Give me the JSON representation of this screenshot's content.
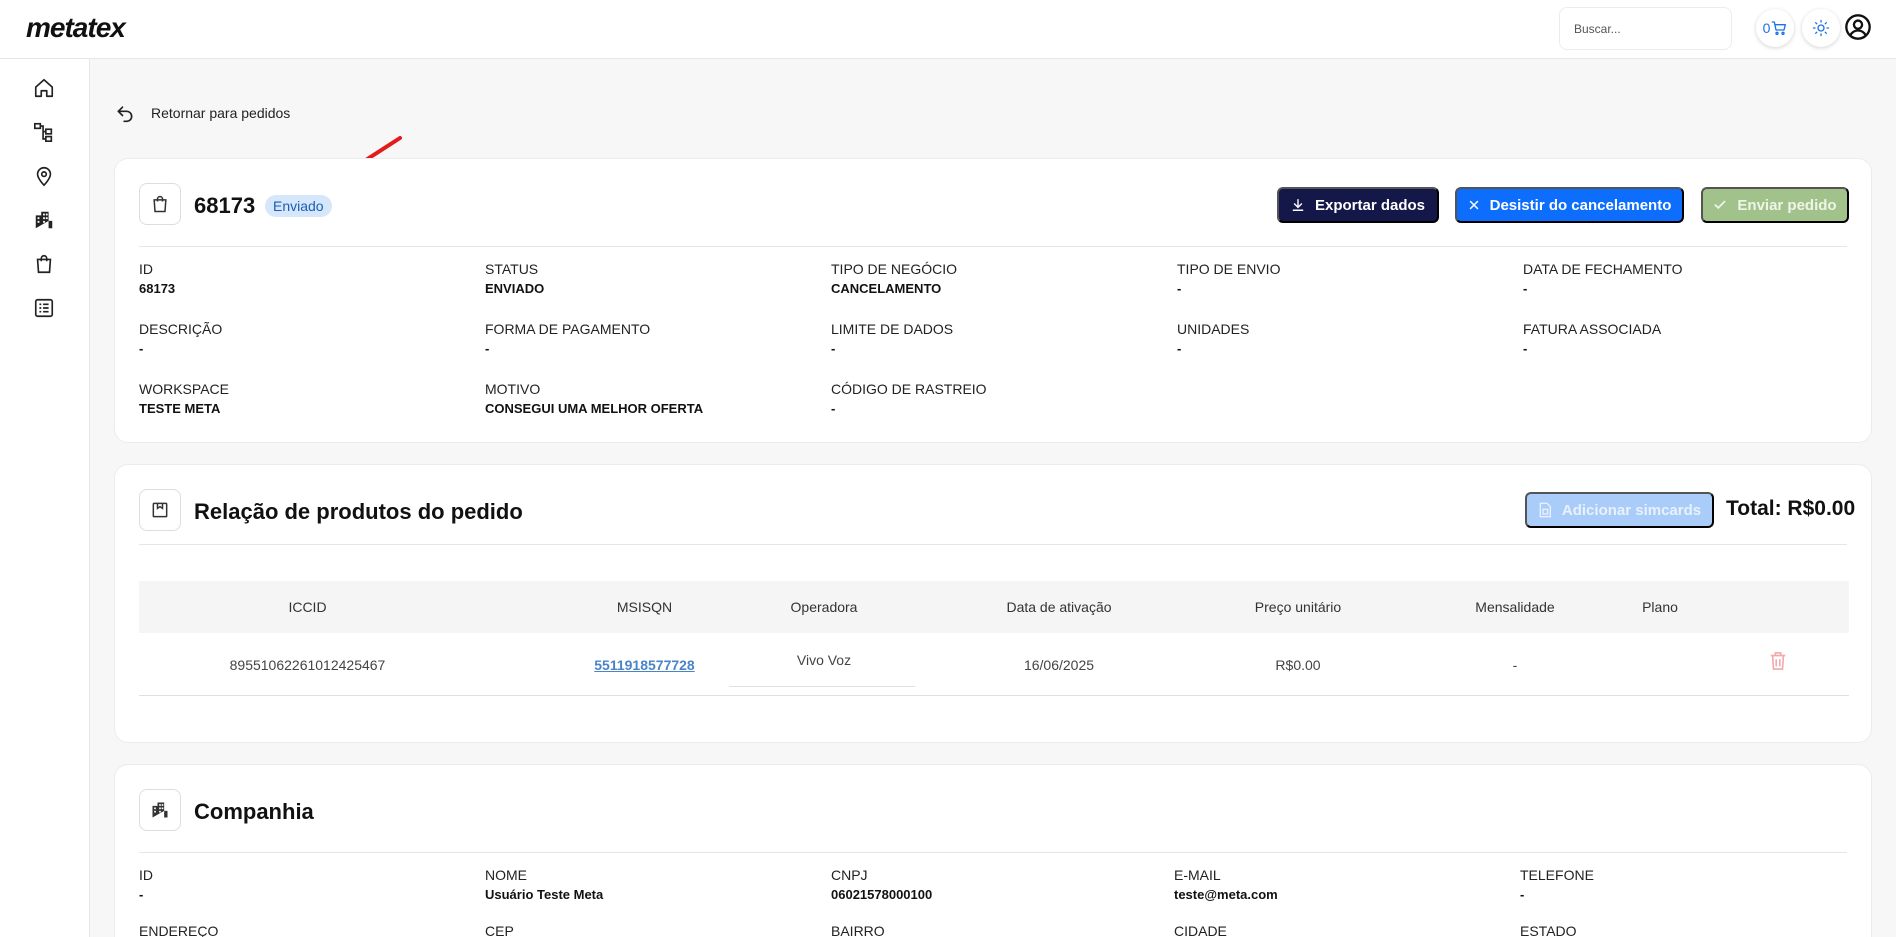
{
  "header": {
    "logo": "metatex",
    "search_placeholder": "Buscar...",
    "cart_count": "0"
  },
  "back_link": "Retornar para pedidos",
  "order": {
    "id": "68173",
    "status_badge": "Enviado",
    "buttons": {
      "export": "Exportar dados",
      "cancel": "Desistir do cancelamento",
      "send": "Enviar pedido"
    },
    "fields": [
      {
        "label": "ID",
        "value": "68173"
      },
      {
        "label": "STATUS",
        "value": "ENVIADO"
      },
      {
        "label": "TIPO DE NEGÓCIO",
        "value": "CANCELAMENTO"
      },
      {
        "label": "TIPO DE ENVIO",
        "value": "-"
      },
      {
        "label": "DATA DE FECHAMENTO",
        "value": "-"
      },
      {
        "label": "DESCRIÇÃO",
        "value": "-"
      },
      {
        "label": "FORMA DE PAGAMENTO",
        "value": "-"
      },
      {
        "label": "LIMITE DE DADOS",
        "value": "-"
      },
      {
        "label": "UNIDADES",
        "value": "-"
      },
      {
        "label": "FATURA ASSOCIADA",
        "value": "-"
      },
      {
        "label": "WORKSPACE",
        "value": "TESTE META"
      },
      {
        "label": "MOTIVO",
        "value": "CONSEGUI UMA MELHOR OFERTA"
      },
      {
        "label": "CÓDIGO DE RASTREIO",
        "value": "-"
      }
    ]
  },
  "products": {
    "title": "Relação de produtos do pedido",
    "add_button": "Adicionar simcards",
    "total": "Total: R$0.00",
    "columns": [
      "ICCID",
      "MSISQN",
      "Operadora",
      "Data de ativação",
      "Preço unitário",
      "Mensalidade",
      "Plano"
    ],
    "rows": [
      {
        "iccid": "89551062261012425467",
        "msisdn": "5511918577728",
        "operadora": "Vivo Voz",
        "data": "16/06/2025",
        "preco": "R$0.00",
        "mensalidade": "-",
        "plano": ""
      }
    ]
  },
  "company": {
    "title": "Companhia",
    "fields": [
      {
        "label": "ID",
        "value": "-"
      },
      {
        "label": "NOME",
        "value": "Usuário Teste Meta"
      },
      {
        "label": "CNPJ",
        "value": "06021578000100"
      },
      {
        "label": "E-MAIL",
        "value": "teste@meta.com"
      },
      {
        "label": "TELEFONE",
        "value": "-"
      },
      {
        "label": "ENDEREÇO",
        "value": ""
      },
      {
        "label": "CEP",
        "value": ""
      },
      {
        "label": "BAIRRO",
        "value": ""
      },
      {
        "label": "CIDADE",
        "value": ""
      },
      {
        "label": "ESTADO",
        "value": ""
      }
    ]
  },
  "colors": {
    "primary_dark": "#141849",
    "primary_blue": "#0d6efd",
    "success_disabled": "#a1c28a",
    "badge_bg": "#d6e6fb",
    "link": "#4a84c8",
    "danger_light": "#f3a9a9"
  }
}
